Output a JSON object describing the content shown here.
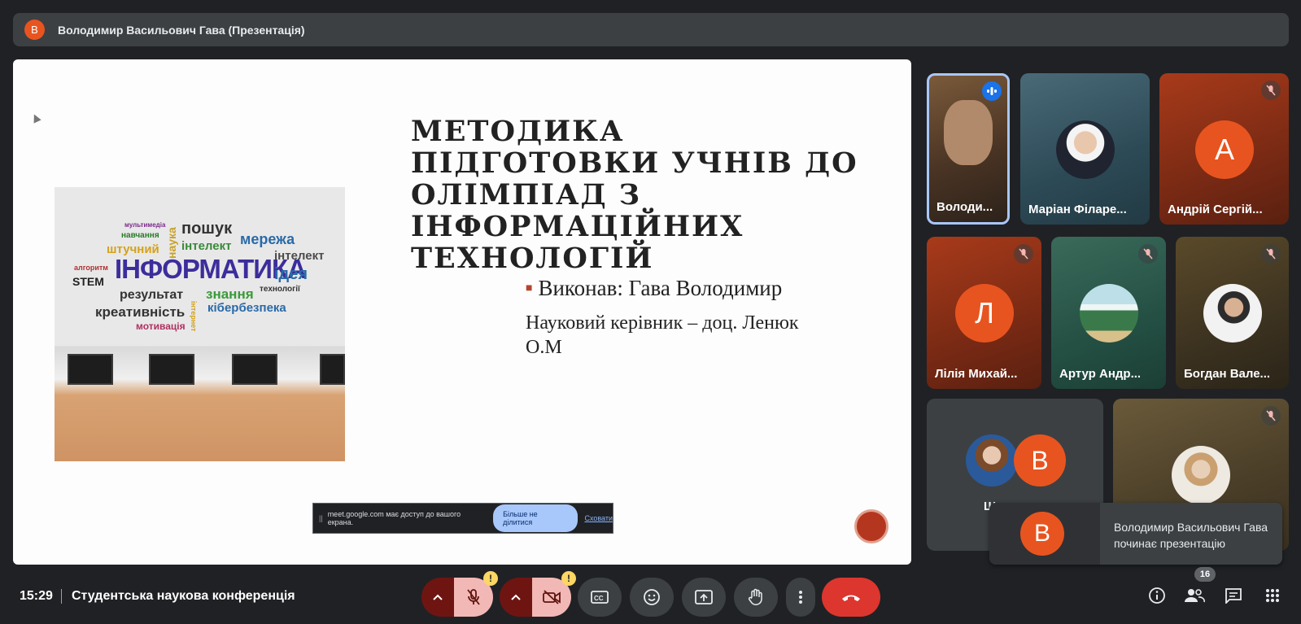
{
  "header": {
    "avatar_letter": "В",
    "title": "Володимир Васильович Гава (Презентація)"
  },
  "slide": {
    "title": "МЕТОДИКА ПІДГОТОВКИ УЧНІВ ДО ОЛІМПІАД З ІНФОРМАЦІЙНИХ ТЕХНОЛОГІЙ",
    "performer": "Виконав: Гава Володимир",
    "supervisor": "Науковий керівник – доц. Ленюк О.М",
    "image_words": {
      "w1": "мультимедіа",
      "w2": "навчання",
      "w3": "штучний",
      "w4": "наука",
      "w5": "пошук",
      "w6": "інтелект",
      "w7": "мережа",
      "w8": "алгоритм",
      "w9": "STEM",
      "w10": "ІНФОРМАТИКА",
      "w11": "інтелект",
      "w12": "ідея",
      "w13": "результат",
      "w14": "знання",
      "w15": "технології",
      "w16": "креативність",
      "w17": "кібербезпека",
      "w18": "мотивація",
      "w19": "інтернет"
    }
  },
  "share_bar": {
    "text": "meet.google.com має доступ до вашого екрана.",
    "stop_label": "Більше не ділитися",
    "hide_label": "Сховати"
  },
  "participants": [
    {
      "name": "Володи...",
      "speaking": true
    },
    {
      "name": "Маріан Філаре...",
      "muted": false
    },
    {
      "name": "Андрій Сергій...",
      "avatar_letter": "А",
      "muted": true
    },
    {
      "name": "Лілія Михай...",
      "avatar_letter": "Л",
      "muted": true
    },
    {
      "name": "Артур Андр...",
      "muted": true
    },
    {
      "name": "Богдан Вале...",
      "muted": true
    },
    {
      "name": "Ш...",
      "avatar_letter": "В"
    },
    {
      "name": "",
      "muted": true
    }
  ],
  "toast": {
    "avatar_letter": "В",
    "message": "Володимир Васильович Гава починає презентацію"
  },
  "bottom": {
    "time": "15:29",
    "meeting_name": "Студентська наукова конференція",
    "participant_count": "16",
    "warn_symbol": "!"
  },
  "colors": {
    "background": "#202124",
    "avatar_orange": "#e8541f",
    "hangup_red": "#dc362e",
    "muted_control_bg": "#f2b8b5",
    "speaking_blue": "#a8c7fa"
  }
}
